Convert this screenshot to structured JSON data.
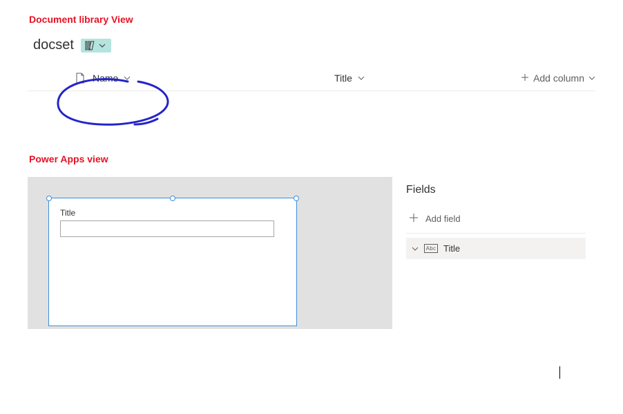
{
  "doc_view": {
    "heading": "Document library View",
    "library_name": "docset",
    "columns": {
      "name_label": "Name",
      "title_label": "Title",
      "add_column_label": "Add column"
    }
  },
  "pa_view": {
    "heading": "Power Apps view",
    "form": {
      "title_field_label": "Title"
    },
    "fields_pane": {
      "heading": "Fields",
      "add_field_label": "Add field",
      "items": [
        {
          "label": "Title",
          "type_abbr": "Abc"
        }
      ]
    }
  }
}
